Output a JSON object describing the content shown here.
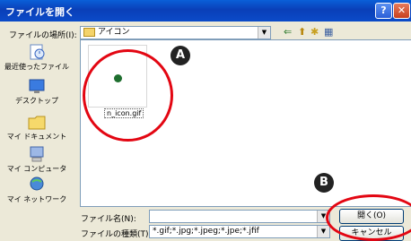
{
  "window": {
    "title": "ファイルを開く",
    "help_glyph": "?",
    "close_glyph": "✕"
  },
  "location": {
    "label": "ファイルの場所(I):",
    "value": "アイコン"
  },
  "toolbar": {
    "back_icon": "⇐",
    "up_icon": "⬆",
    "new_folder_icon": "✱",
    "view_icon": "▦"
  },
  "places": [
    {
      "label": "最近使ったファイル"
    },
    {
      "label": "デスクトップ"
    },
    {
      "label": "マイ ドキュメント"
    },
    {
      "label": "マイ コンピュータ"
    },
    {
      "label": "マイ ネットワーク"
    }
  ],
  "files": [
    {
      "name": "n_icon.gif"
    }
  ],
  "filename": {
    "label": "ファイル名(N):",
    "value": ""
  },
  "filetype": {
    "label": "ファイルの種類(T):",
    "value": "*.gif;*.jpg;*.jpeg;*.jpe;*.jfif"
  },
  "buttons": {
    "open": "開く(O)",
    "cancel": "キャンセル"
  },
  "annotations": {
    "a": "A",
    "b": "B"
  },
  "colors": {
    "accent": "#0A3FB8",
    "annotation": "#E30612"
  }
}
